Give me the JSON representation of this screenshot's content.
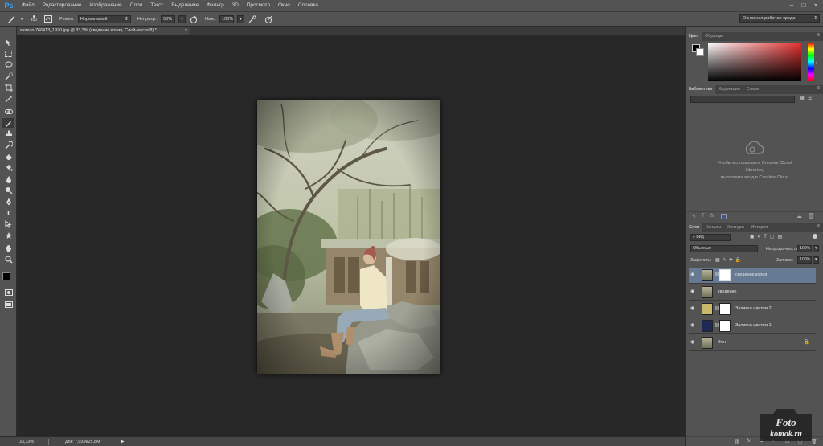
{
  "app": {
    "logo": "Ps",
    "accent": "#31a8ff"
  },
  "menu": [
    "Файл",
    "Редактирование",
    "Изображение",
    "Слои",
    "Текст",
    "Выделение",
    "Фильтр",
    "3D",
    "Просмотр",
    "Окно",
    "Справка"
  ],
  "options": {
    "brush_size": "450",
    "mode_label": "Режим:",
    "mode_value": "Нормальный",
    "opacity_label": "Непрозр.:",
    "opacity_value": "50%",
    "flow_label": "Наж.:",
    "flow_value": "100%",
    "workspace": "Основная рабочая среда"
  },
  "document_tab": {
    "title": "woman-766413_1920.jpg @ 33,3% (сведение копия, Слой-маска/8) *",
    "close": "×"
  },
  "status": {
    "zoom": "33,33%",
    "doc": "Док: 7,03M/25,8M"
  },
  "color_panel": {
    "tabs": [
      "Цвет",
      "Образцы"
    ]
  },
  "libraries_panel": {
    "tabs": [
      "Библиотеки",
      "Коррекция",
      "Стили"
    ],
    "message": [
      "Чтобы использовать Creative Cloud",
      "Libraries,",
      "выполните вход в Creative Cloud"
    ]
  },
  "layers_panel": {
    "tabs": [
      "Слои",
      "Каналы",
      "Контуры",
      "История"
    ],
    "filter": "Вид",
    "blend_mode": "Обычные",
    "opacity_label": "Непрозрачность:",
    "opacity_value": "100%",
    "lock_label": "Закрепить:",
    "fill_label": "Заливка:",
    "fill_value": "100%",
    "layers": [
      {
        "name": "сведение копия",
        "selected": true,
        "thumb": "photo",
        "mask": true
      },
      {
        "name": "сведение",
        "selected": false,
        "thumb": "photo",
        "mask": false
      },
      {
        "name": "Заливка цветом 2",
        "selected": false,
        "thumb": "#c9b96a",
        "mask": true
      },
      {
        "name": "Заливка цветом 1",
        "selected": false,
        "thumb": "#1c2a55",
        "mask": true
      },
      {
        "name": "Фон",
        "selected": false,
        "thumb": "photo",
        "mask": false,
        "locked": true
      }
    ]
  },
  "watermark": {
    "line1": "Foto",
    "line2": "komok.ru"
  }
}
